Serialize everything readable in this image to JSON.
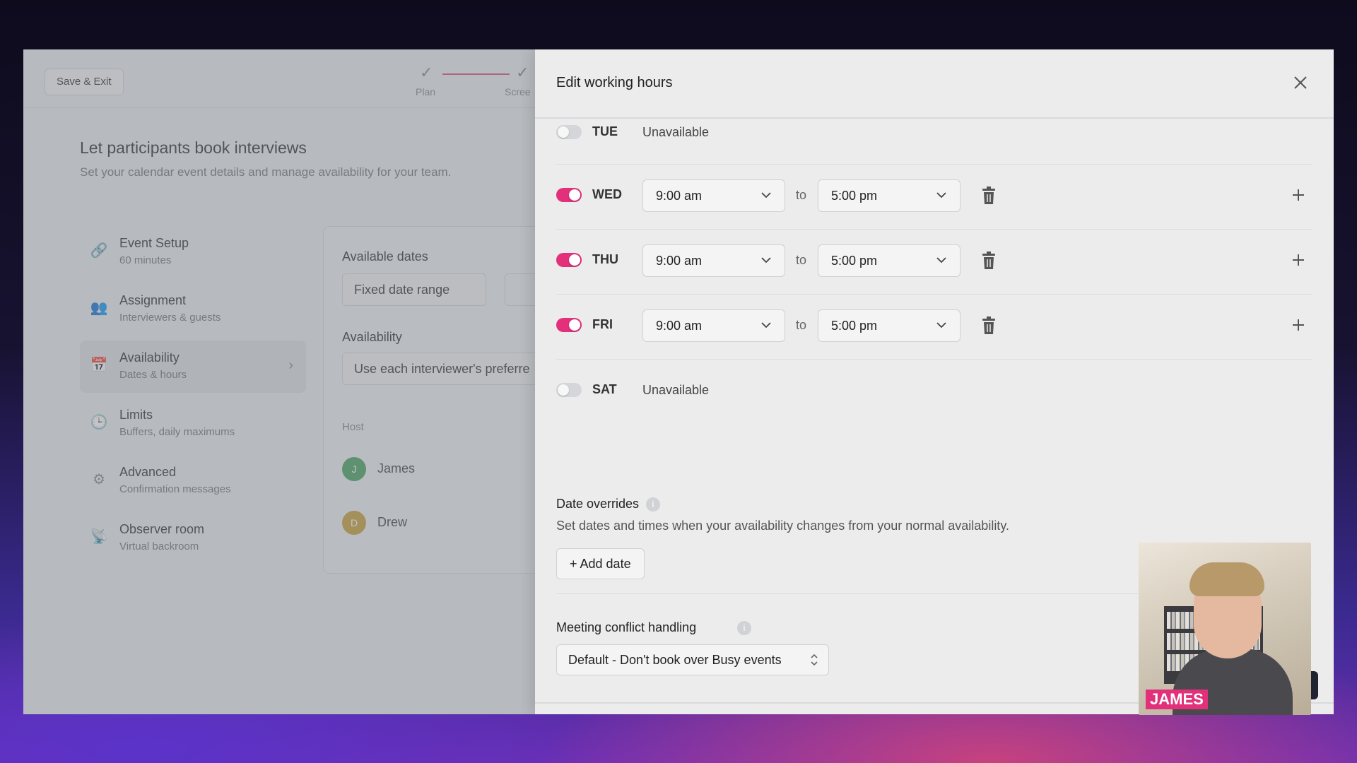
{
  "background_page": {
    "save_exit_label": "Save & Exit",
    "stepper": {
      "step1": "Plan",
      "step2": "Scree"
    },
    "title": "Let participants book interviews",
    "subtitle": "Set your calendar event details and manage availability for your team.",
    "sidebar": [
      {
        "title": "Event Setup",
        "sub": "60 minutes",
        "icon": "link-icon"
      },
      {
        "title": "Assignment",
        "sub": "Interviewers & guests",
        "icon": "people-icon"
      },
      {
        "title": "Availability",
        "sub": "Dates & hours",
        "icon": "calendar-icon"
      },
      {
        "title": "Limits",
        "sub": "Buffers, daily maximums",
        "icon": "clock-icon"
      },
      {
        "title": "Advanced",
        "sub": "Confirmation messages",
        "icon": "sliders-icon"
      },
      {
        "title": "Observer room",
        "sub": "Virtual backroom",
        "icon": "broadcast-icon"
      }
    ],
    "panel": {
      "available_dates_label": "Available dates",
      "available_dates_value": "Fixed date range",
      "availability_label": "Availability",
      "availability_value": "Use each interviewer's preferre",
      "host_label": "Host",
      "hosts": [
        {
          "initial": "J",
          "name": "James",
          "color": "#4aa35f"
        },
        {
          "initial": "D",
          "name": "Drew",
          "color": "#c9a13a"
        }
      ]
    }
  },
  "drawer": {
    "title": "Edit working hours",
    "days": [
      {
        "day": "TUE",
        "enabled": false,
        "status": "Unavailable"
      },
      {
        "day": "WED",
        "enabled": true,
        "start": "9:00 am",
        "end": "5:00 pm"
      },
      {
        "day": "THU",
        "enabled": true,
        "start": "9:00 am",
        "end": "5:00 pm"
      },
      {
        "day": "FRI",
        "enabled": true,
        "start": "9:00 am",
        "end": "5:00 pm"
      },
      {
        "day": "SAT",
        "enabled": false,
        "status": "Unavailable"
      }
    ],
    "to_label": "to",
    "date_overrides": {
      "title": "Date overrides",
      "description": "Set dates and times when your availability changes from your normal availability.",
      "add_button": "+ Add date"
    },
    "meeting_conflict": {
      "title": "Meeting conflict handling",
      "value": "Default - Don't book over Busy events"
    }
  },
  "webcam": {
    "name": "JAMES"
  },
  "colors": {
    "accent": "#e2307a",
    "toggle_off": "#d5d6d9"
  }
}
